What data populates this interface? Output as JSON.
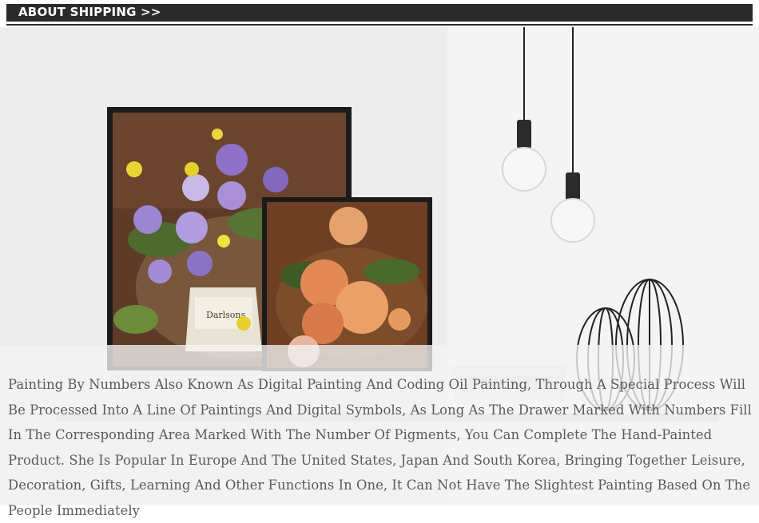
{
  "header": {
    "title": "ABOUT SHIPPING >>"
  },
  "scene": {
    "bouquet_label": "Darlsons"
  },
  "description": {
    "text": "Painting By Numbers Also Known As Digital Painting And Coding Oil Painting, Through A Special Process Will Be Processed Into A Line Of Paintings And Digital Symbols, As Long As The Drawer Marked With Numbers Fill In The Corresponding Area Marked With The Number Of Pigments, You Can Complete The Hand-Painted Product. She Is Popular In Europe And The United States, Japan And South Korea, Bringing Together Leisure, Decoration, Gifts, Learning And Other Functions In One, It Can Not Have The Slightest Painting Based On The People Immediately"
  },
  "colors": {
    "header_bg": "#2a2a2a",
    "header_text": "#ffffff",
    "body_text": "#5a5a5a"
  }
}
